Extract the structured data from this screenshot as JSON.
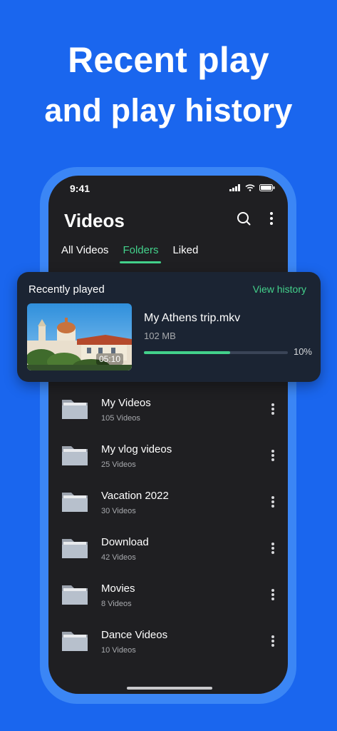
{
  "headline": {
    "line1": "Recent play",
    "line2": "and play history"
  },
  "status_bar": {
    "time": "9:41"
  },
  "app": {
    "title": "Videos",
    "tabs": [
      {
        "label": "All Videos",
        "active": false
      },
      {
        "label": "Folders",
        "active": true
      },
      {
        "label": "Liked",
        "active": false
      }
    ]
  },
  "recent": {
    "title": "Recently played",
    "view_history": "View history",
    "video": {
      "name": "My Athens trip.mkv",
      "size": "102 MB",
      "duration": "05:10",
      "progress_percent": 10,
      "progress_label": "10%",
      "progress_fill_fraction": 0.6
    }
  },
  "folders": [
    {
      "name": "My Videos",
      "count": "105 Videos"
    },
    {
      "name": "My vlog videos",
      "count": "25 Videos"
    },
    {
      "name": "Vacation 2022",
      "count": "30 Videos"
    },
    {
      "name": "Download",
      "count": "42 Videos"
    },
    {
      "name": "Movies",
      "count": "8 Videos"
    },
    {
      "name": "Dance Videos",
      "count": "10 Videos"
    }
  ],
  "colors": {
    "background": "#1a66ee",
    "accent": "#43d18b",
    "screen": "#1f1f22",
    "card": "#1b2433"
  },
  "icons": {
    "search": "search-icon",
    "more": "more-vertical-icon",
    "folder": "folder-icon"
  }
}
